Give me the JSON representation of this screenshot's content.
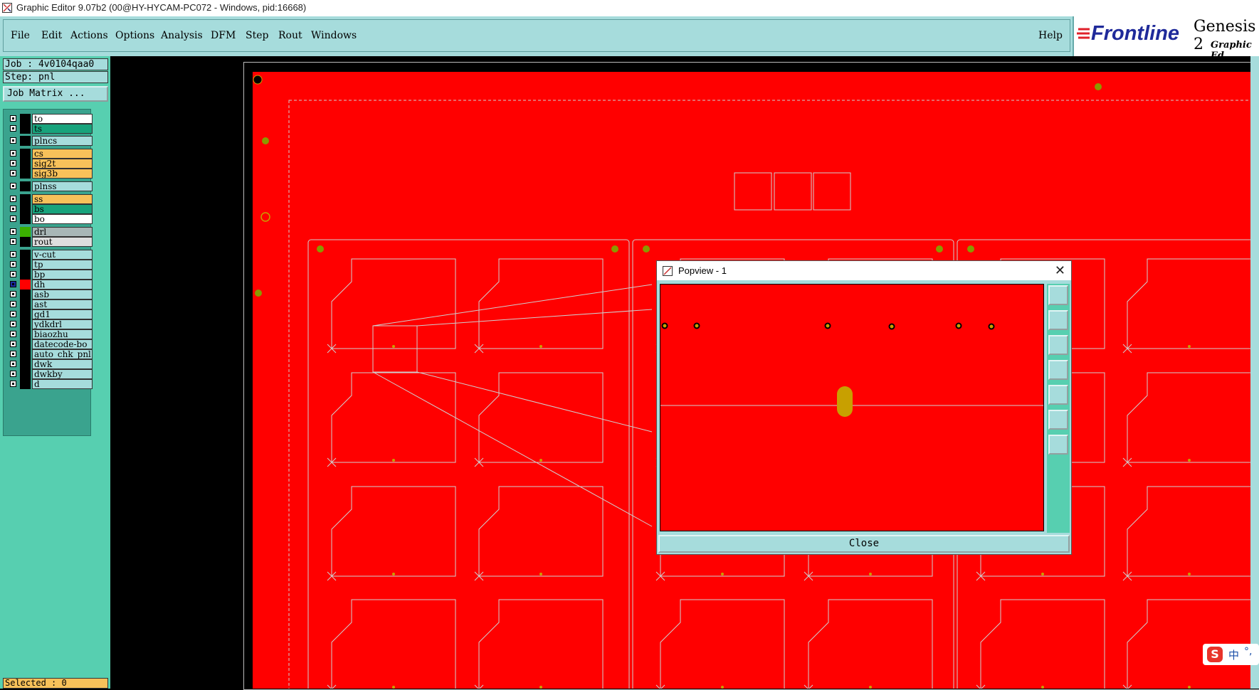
{
  "window": {
    "title": "Graphic Editor 9.07b2 (00@HY-HYCAM-PC072 - Windows, pid:16668)"
  },
  "menu": {
    "items": [
      {
        "label": "File"
      },
      {
        "label": "Edit"
      },
      {
        "label": "Actions"
      },
      {
        "label": "Options"
      },
      {
        "label": "Analysis"
      },
      {
        "label": "DFM"
      },
      {
        "label": "Step"
      },
      {
        "label": "Rout"
      },
      {
        "label": "Windows"
      }
    ],
    "help": "Help"
  },
  "logo": {
    "brand": "Frontline",
    "product": "Genesis 2",
    "subtitle": "Graphic Ed"
  },
  "job": {
    "job_line": "Job : 4v0104qaa0",
    "step_line": "Step: pnl",
    "matrix_button": "Job Matrix ..."
  },
  "layers": [
    {
      "name": "to",
      "color": "#ffffff",
      "swatch": "#000000"
    },
    {
      "name": "ts",
      "color": "#18a37c",
      "swatch": "#000000"
    },
    {
      "name": "plncs",
      "color": "#a6dcdc",
      "swatch": "#000000"
    },
    {
      "name": "cs",
      "color": "#f7c15a",
      "swatch": "#000000"
    },
    {
      "name": "sig2t",
      "color": "#f7c15a",
      "swatch": "#000000"
    },
    {
      "name": "sig3b",
      "color": "#f7c15a",
      "swatch": "#000000"
    },
    {
      "name": "plnss",
      "color": "#a6dcdc",
      "swatch": "#000000"
    },
    {
      "name": "ss",
      "color": "#f7c15a",
      "swatch": "#000000"
    },
    {
      "name": "bs",
      "color": "#18a37c",
      "swatch": "#000000"
    },
    {
      "name": "bo",
      "color": "#ffffff",
      "swatch": "#000000"
    },
    {
      "name": "drl",
      "color": "#a8b6b6",
      "swatch": "#3bb000"
    },
    {
      "name": "rout",
      "color": "#dedede",
      "swatch": "#000000"
    },
    {
      "name": "v-cut",
      "color": "#a6dcdc",
      "swatch": "#000000"
    },
    {
      "name": "tp",
      "color": "#a6dcdc",
      "swatch": "#000000"
    },
    {
      "name": "bp",
      "color": "#a6dcdc",
      "swatch": "#000000"
    },
    {
      "name": "dh",
      "color": "#a6dcdc",
      "swatch": "#ff0000",
      "active": true
    },
    {
      "name": "asb",
      "color": "#a6dcdc",
      "swatch": "#000000"
    },
    {
      "name": "ast",
      "color": "#a6dcdc",
      "swatch": "#000000"
    },
    {
      "name": "gd1",
      "color": "#a6dcdc",
      "swatch": "#000000"
    },
    {
      "name": "ydkdrl",
      "color": "#a6dcdc",
      "swatch": "#000000"
    },
    {
      "name": "biaozhu",
      "color": "#a6dcdc",
      "swatch": "#000000"
    },
    {
      "name": "datecode-bo",
      "color": "#a6dcdc",
      "swatch": "#000000"
    },
    {
      "name": "auto_chk_pnl",
      "color": "#a6dcdc",
      "swatch": "#000000"
    },
    {
      "name": "dwk",
      "color": "#a6dcdc",
      "swatch": "#000000"
    },
    {
      "name": "dwkby",
      "color": "#a6dcdc",
      "swatch": "#000000"
    },
    {
      "name": "d",
      "color": "#a6dcdc",
      "swatch": "#000000"
    }
  ],
  "status": {
    "selected": "Selected : 0"
  },
  "popview": {
    "title": "Popview - 1",
    "close_label": "Close",
    "tools": [
      "zoom-window-icon",
      "pan-up-icon",
      "pan-down-icon",
      "pan-left-icon",
      "pan-right-icon",
      "zoom-fit-icon",
      "zoom-center-icon"
    ]
  },
  "ime": {
    "logo": "S",
    "mode": "中",
    "punct": "°,"
  },
  "colors": {
    "pcb": "#ff0000",
    "panel": "#a6dcdc",
    "accent": "#57cfb0",
    "pad": "#c8a000",
    "outline": "#cfcfcf"
  }
}
